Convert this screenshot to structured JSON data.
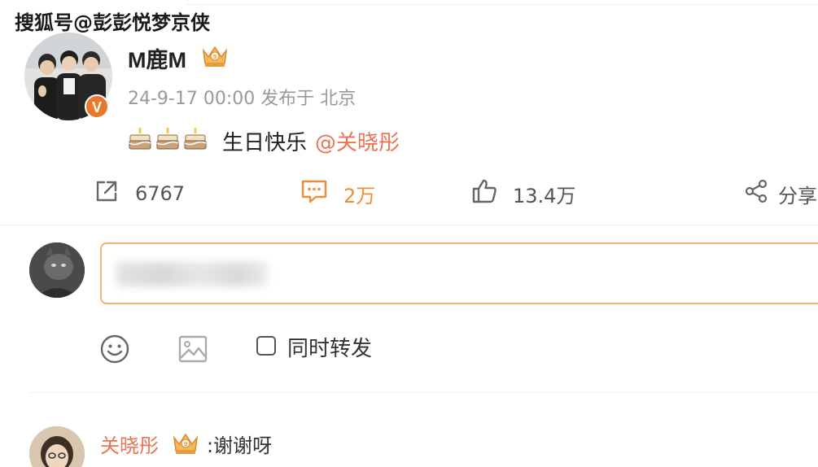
{
  "watermark": "搜狐号@彭彭悦梦京侠",
  "post": {
    "username": "M鹿M",
    "timestamp": "24-9-17 00:00 发布于 北京",
    "text": "生日快乐",
    "mention": "@关晓彤",
    "cake_emoji_count": 3,
    "verified_badge": "V"
  },
  "actions": {
    "share_count": "6767",
    "comment_count": "2万",
    "like_count": "13.4万",
    "forward_label": "分享"
  },
  "composer": {
    "placeholder": "",
    "repost_label": "同时转发",
    "repost_checked": false
  },
  "reply": {
    "name": "关晓彤",
    "text": ":谢谢呀"
  },
  "colors": {
    "accent": "#eb7350",
    "comment_orange": "#f08c38",
    "input_border": "#f1b46a",
    "muted": "#999999"
  },
  "icons": {
    "share": "share-out-icon",
    "comment": "comment-icon",
    "like": "thumbs-up-icon",
    "forward": "share-nodes-icon",
    "emoji": "smiley-icon",
    "image": "image-icon",
    "crown": "crown-badge-icon",
    "cake": "cake-icon"
  }
}
